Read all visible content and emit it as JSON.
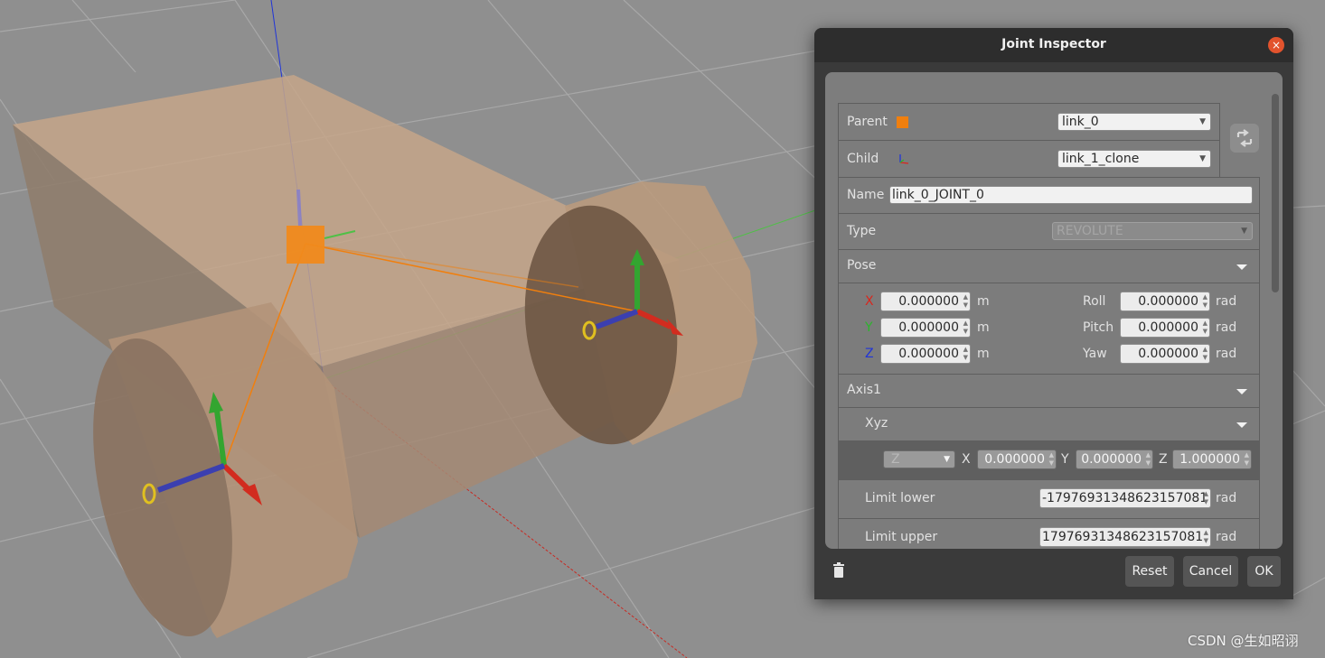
{
  "dialog": {
    "title": "Joint Inspector",
    "close_glyph": "×",
    "parent": {
      "label": "Parent",
      "value": "link_0"
    },
    "child": {
      "label": "Child",
      "value": "link_1_clone"
    },
    "name": {
      "label": "Name",
      "value": "link_0_JOINT_0"
    },
    "type": {
      "label": "Type",
      "value": "REVOLUTE"
    },
    "pose": {
      "label": "Pose",
      "x_label": "X",
      "y_label": "Y",
      "z_label": "Z",
      "x": "0.000000",
      "y": "0.000000",
      "z": "0.000000",
      "roll_label": "Roll",
      "pitch_label": "Pitch",
      "yaw_label": "Yaw",
      "roll": "0.000000",
      "pitch": "0.000000",
      "yaw": "0.000000",
      "length_unit": "m",
      "angle_unit": "rad"
    },
    "axis1": {
      "label": "Axis1",
      "xyz_label": "Xyz",
      "preset": "Z",
      "x_label": "X",
      "y_label": "Y",
      "z_label": "Z",
      "x": "0.000000",
      "y": "0.000000",
      "z": "1.000000",
      "limit_lower_label": "Limit lower",
      "limit_lower": "-17976931348623157081",
      "limit_upper_label": "Limit upper",
      "limit_upper": "17976931348623157081",
      "unit": "rad"
    },
    "buttons": {
      "reset": "Reset",
      "cancel": "Cancel",
      "ok": "OK"
    },
    "colors": {
      "x_axis": "#d9261c",
      "y_axis": "#2bb52b",
      "z_axis": "#2035d8",
      "parent_marker": "#f07f0e"
    }
  },
  "watermark": "CSDN @生如昭诩"
}
